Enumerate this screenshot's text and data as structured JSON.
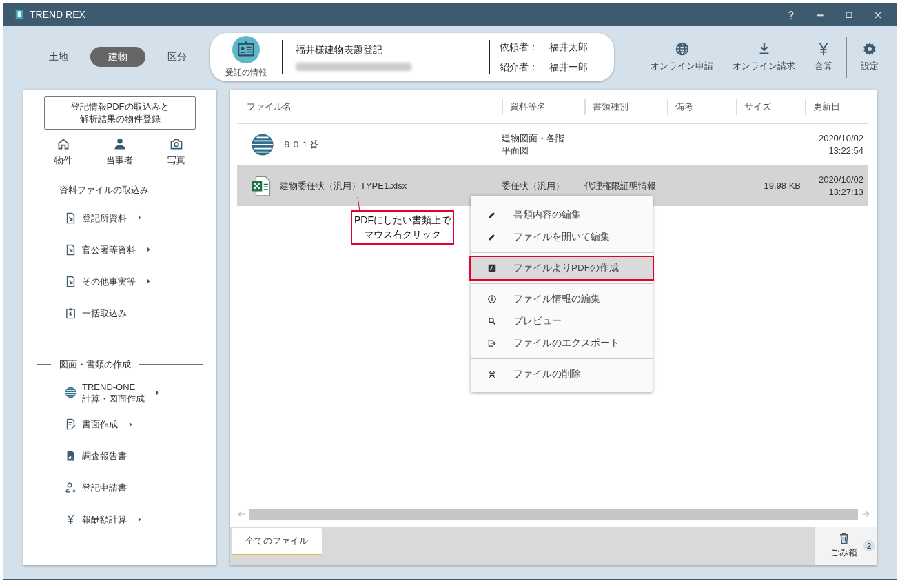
{
  "window": {
    "title": "TREND REX"
  },
  "mode_tabs": [
    {
      "label": "土地",
      "selected": false
    },
    {
      "label": "建物",
      "selected": true
    },
    {
      "label": "区分",
      "selected": false
    }
  ],
  "case_info": {
    "button_label": "受託の情報",
    "title": "福井様建物表題登記",
    "client_label": "依頼者：",
    "client": "福井太郎",
    "referrer_label": "紹介者：",
    "referrer": "福井一郎"
  },
  "toolbar": [
    {
      "label": "オンライン申請"
    },
    {
      "label": "オンライン請求"
    },
    {
      "label": "合算"
    },
    {
      "label": "設定"
    }
  ],
  "sidebar": {
    "import_button": "登記情報PDFの取込みと解析結果の物件登録",
    "quick_links": [
      {
        "label": "物件"
      },
      {
        "label": "当事者"
      },
      {
        "label": "写真"
      }
    ],
    "sections": [
      {
        "title": "資料ファイルの取込み",
        "items": [
          {
            "label": "登記所資料",
            "has_submenu": true
          },
          {
            "label": "官公署等資料",
            "has_submenu": true
          },
          {
            "label": "その他事実等",
            "has_submenu": true
          },
          {
            "label": "一括取込み",
            "has_submenu": false
          }
        ]
      },
      {
        "title": "図面・書類の作成",
        "items": [
          {
            "label": "TREND-ONE\n計算・図面作成",
            "has_submenu": true
          },
          {
            "label": "書面作成",
            "has_submenu": true
          },
          {
            "label": "調査報告書",
            "has_submenu": false
          },
          {
            "label": "登記申請書",
            "has_submenu": false
          },
          {
            "label": "報酬額計算",
            "has_submenu": true
          }
        ]
      }
    ]
  },
  "files": {
    "columns": [
      "ファイル名",
      "資料等名",
      "書類種別",
      "備考",
      "サイズ",
      "更新日"
    ],
    "rows": [
      {
        "kind": "drawing",
        "name": "９０１番",
        "material": "建物図面・各階平面図",
        "doc_type": "",
        "note": "",
        "size": "",
        "updated": "2020/10/02\n13:22:54",
        "selected": false
      },
      {
        "kind": "excel",
        "name": "建物委任状（汎用）TYPE1.xlsx",
        "material": "委任状（汎用）",
        "doc_type": "代理権限証明情報",
        "note": "",
        "size": "19.98 KB",
        "updated": "2020/10/02\n13:27:13",
        "selected": true
      }
    ]
  },
  "context_menu": {
    "groups": [
      [
        {
          "label": "書類内容の編集",
          "selected": false
        },
        {
          "label": "ファイルを開いて編集",
          "selected": false
        }
      ],
      [
        {
          "label": "ファイルよりPDFの作成",
          "selected": true
        }
      ],
      [
        {
          "label": "ファイル情報の編集",
          "selected": false
        },
        {
          "label": "プレビュー",
          "selected": false
        },
        {
          "label": "ファイルのエクスポート",
          "selected": false
        }
      ],
      [
        {
          "label": "ファイルの削除",
          "selected": false
        }
      ]
    ]
  },
  "callout": "PDFにしたい書類上でマウス右クリック",
  "bottom_tabs": [
    {
      "label": "全てのファイル",
      "selected": true
    }
  ],
  "trash": {
    "label": "ごみ箱",
    "count": "2"
  }
}
